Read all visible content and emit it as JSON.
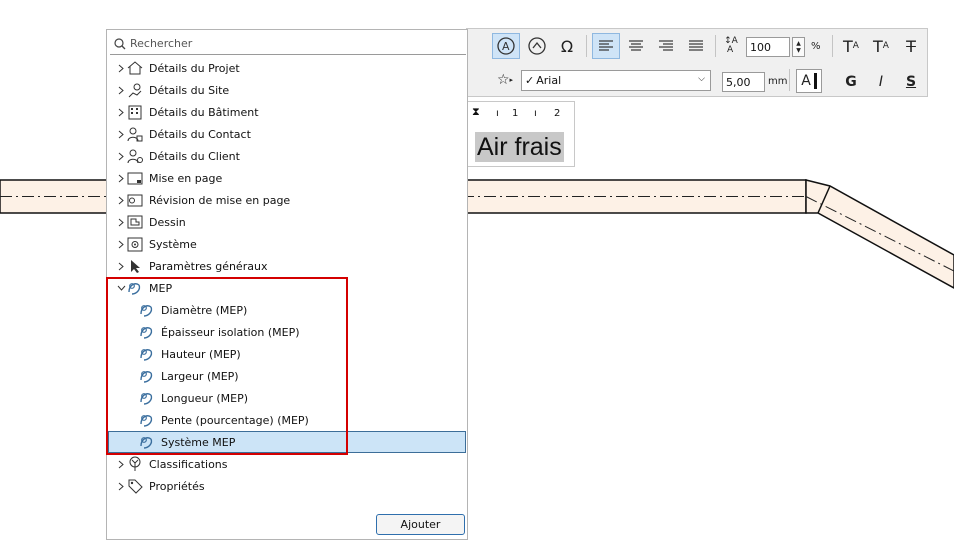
{
  "search": {
    "placeholder": "Rechercher"
  },
  "tree": {
    "items": [
      {
        "label": "Détails du Projet",
        "icon": "house-icon"
      },
      {
        "label": "Détails du Site",
        "icon": "map-pin-icon"
      },
      {
        "label": "Détails du Bâtiment",
        "icon": "building-icon"
      },
      {
        "label": "Détails du Contact",
        "icon": "contact-icon"
      },
      {
        "label": "Détails du Client",
        "icon": "client-icon"
      },
      {
        "label": "Mise en page",
        "icon": "layout-icon"
      },
      {
        "label": "Révision de mise en page",
        "icon": "layout-revision-icon"
      },
      {
        "label": "Dessin",
        "icon": "drawing-icon"
      },
      {
        "label": "Système",
        "icon": "system-gear-icon"
      },
      {
        "label": "Paramètres généraux",
        "icon": "cursor-icon"
      }
    ],
    "mep": {
      "label": "MEP",
      "children": [
        "Diamètre (MEP)",
        "Épaisseur isolation (MEP)",
        "Hauteur (MEP)",
        "Largeur (MEP)",
        "Longueur (MEP)",
        "Pente (pourcentage) (MEP)",
        "Système MEP"
      ],
      "selected": "Système MEP"
    },
    "after": [
      {
        "label": "Classifications",
        "icon": "classification-tree-icon"
      },
      {
        "label": "Propriétés",
        "icon": "tag-icon"
      }
    ]
  },
  "add_button": "Ajouter",
  "toolbar": {
    "scale_value": "100",
    "scale_unit": "%",
    "font_name": "Arial",
    "font_check": "✓",
    "size_value": "5,00",
    "size_unit": "mm",
    "bold": "G",
    "italic": "I",
    "underline": "S",
    "color_letter": "A",
    "superscript": "T",
    "subscript": "T",
    "strikethrough": "T"
  },
  "preview": {
    "ruler_1": "1",
    "ruler_2": "2",
    "text": "Air frais"
  },
  "colors": {
    "duct_fill": "#fdf1e6",
    "highlight": "#d40000",
    "selection": "#cce4f7",
    "active_button": "#cfe4f7"
  }
}
